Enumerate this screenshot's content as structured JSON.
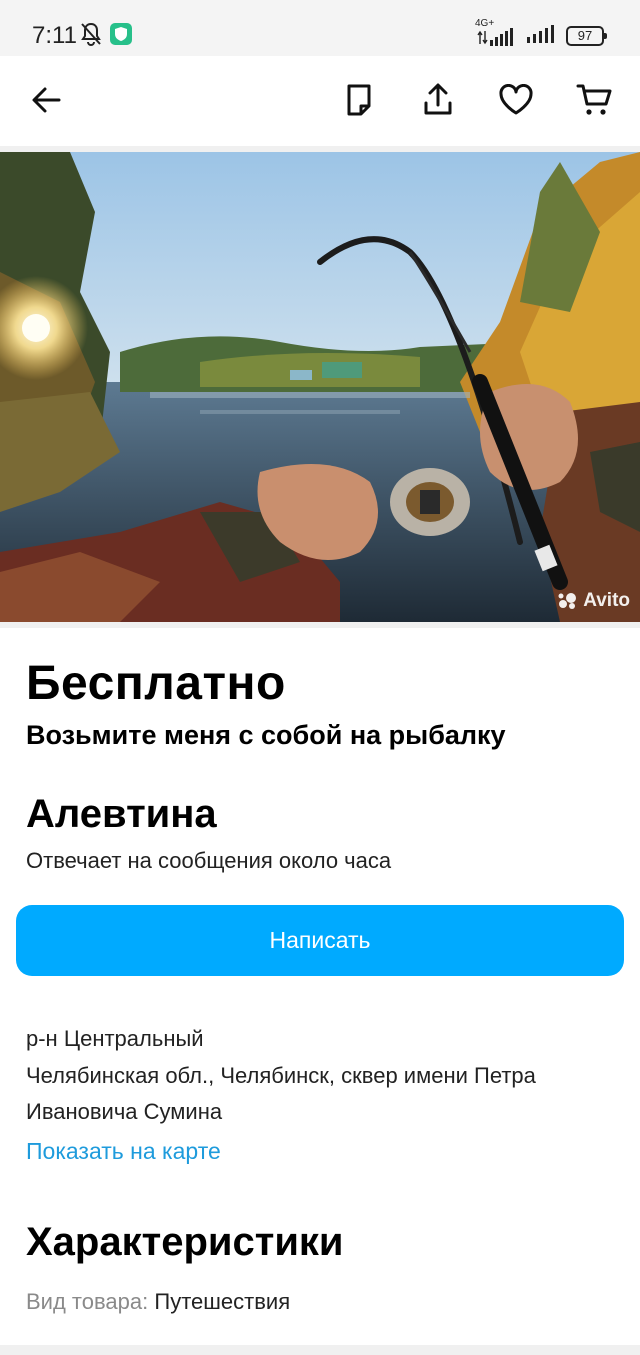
{
  "status_bar": {
    "time": "7:11",
    "network": "4G+",
    "battery": "97"
  },
  "toolbar": {
    "icons": [
      "back-arrow-icon",
      "note-icon",
      "share-icon",
      "heart-icon",
      "cart-icon"
    ]
  },
  "photo": {
    "watermark": "Avito"
  },
  "listing": {
    "price": "Бесплатно",
    "title": "Возьмите меня с собой на рыбалку"
  },
  "seller": {
    "name": "Алевтина",
    "reply_time": "Отвечает на сообщения около часа"
  },
  "actions": {
    "write_label": "Написать"
  },
  "address": {
    "district": "р-н Центральный",
    "line1": "Челябинская обл., Челябинск, сквер имени Петра",
    "line2": "Ивановича Сумина",
    "map_link": "Показать на карте"
  },
  "characteristics": {
    "title": "Характеристики",
    "items": [
      {
        "key": "Вид товара:",
        "value": "Путешествия"
      }
    ]
  },
  "colors": {
    "accent": "#00aaff",
    "link": "#1e9bdc"
  }
}
